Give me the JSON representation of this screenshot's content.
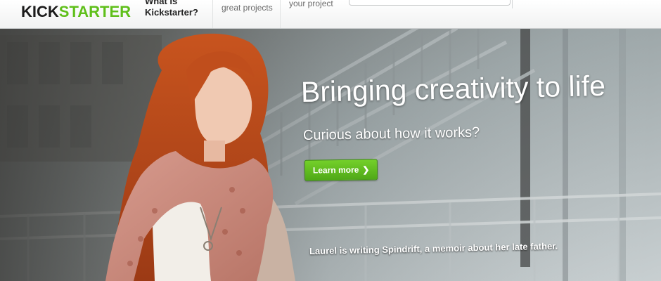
{
  "brand": {
    "logo_part1": "KICK",
    "logo_part2": "STARTER",
    "accent_color": "#5fbf1a"
  },
  "nav": {
    "what_is_line1": "What is",
    "what_is_line2": "Kickstarter?",
    "discover_label": "great projects",
    "start_label": "your project"
  },
  "hero": {
    "headline": "Bringing creativity to life",
    "subheadline": "Curious about how it works?",
    "cta_label": "Learn more",
    "cta_icon": "chevron-right-icon",
    "cta_color": "#5bb81f",
    "caption": "Laurel is writing Spindrift, a memoir about her late father."
  }
}
